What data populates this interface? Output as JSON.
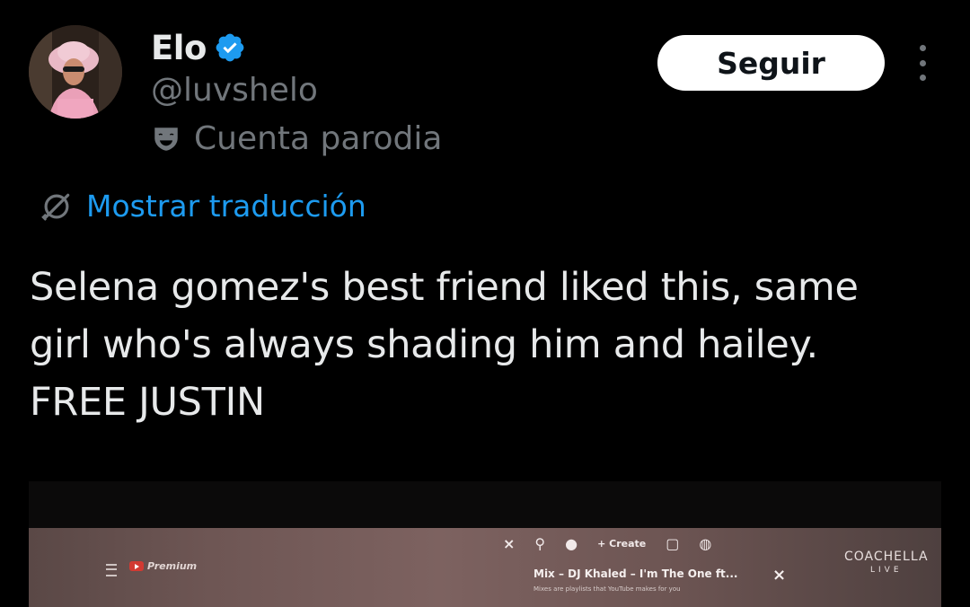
{
  "author": {
    "name": "Elo",
    "handle": "@luvshelo",
    "parody_label": "Cuenta parodia",
    "verified_icon": "verified-badge-icon",
    "parody_icon": "theater-masks-icon",
    "avatar_icon": "avatar-photo"
  },
  "actions": {
    "follow_label": "Seguir",
    "more_icon": "more-options-icon"
  },
  "translate": {
    "label": "Mostrar traducción",
    "icon": "globe-translate-icon"
  },
  "tweet": {
    "lines": [
      "Selena gomez's best friend liked this, same",
      "girl who's always shading him and hailey.",
      "FREE JUSTIN"
    ]
  },
  "media": {
    "premium_label": "Premium",
    "create_label": "+ Create",
    "mix_title": "Mix – DJ Khaled – I'm The One ft...",
    "mix_subtitle": "Mixes are playlists that YouTube makes for you",
    "close_glyph": "×",
    "coachella_line1": "COACHELLA",
    "coachella_line2": "LIVE"
  },
  "colors": {
    "background": "#000000",
    "primary_text": "#e7e9ea",
    "secondary_text": "#71767b",
    "link": "#1d9bf0",
    "verified": "#1d9bf0",
    "follow_bg": "#ffffff"
  }
}
